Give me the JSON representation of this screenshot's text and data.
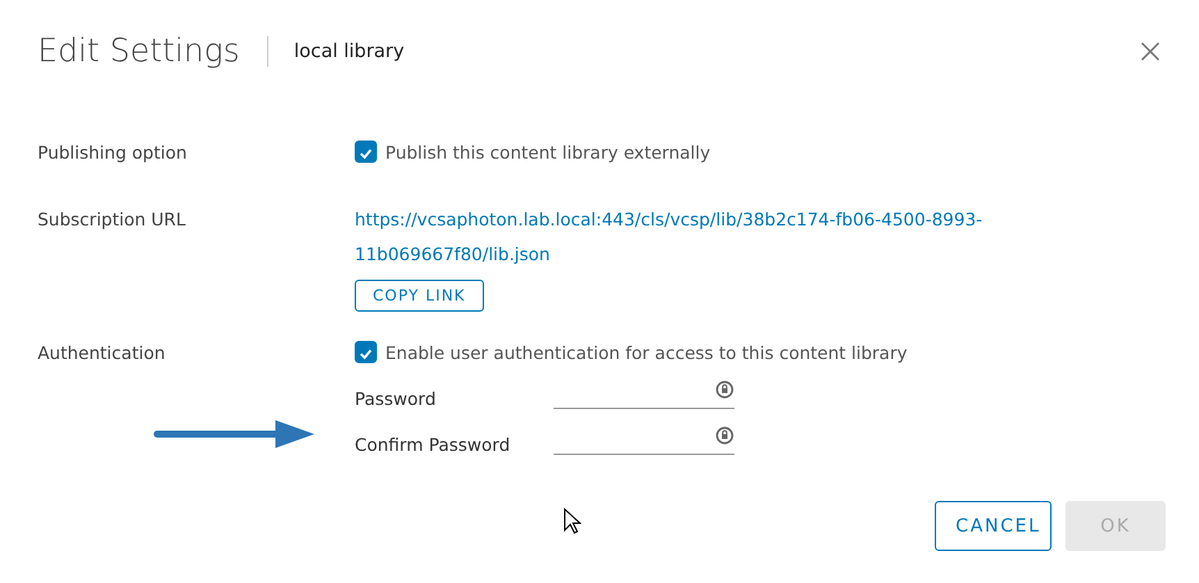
{
  "dialog": {
    "title": "Edit Settings",
    "subtitle": "local library"
  },
  "publishing": {
    "label": "Publishing option",
    "checkbox": {
      "label": "Publish this content library externally",
      "checked": true
    }
  },
  "subscription": {
    "label": "Subscription URL",
    "url_lines": [
      "https://vcsaphoton.lab.local:443/cls/vcsp/lib/38b2c174-fb06-4500-8993-",
      "11b069667f80/lib.json"
    ],
    "copy_button": "COPY LINK"
  },
  "authentication": {
    "label": "Authentication",
    "checkbox": {
      "label": "Enable user authentication for access to this content library",
      "checked": true
    },
    "fields": [
      {
        "label": "Password"
      },
      {
        "label": "Confirm Password"
      }
    ]
  },
  "buttons": [
    {
      "label": "CANCEL",
      "kind": "outline",
      "disabled": false
    },
    {
      "label": "OK",
      "kind": "primary",
      "disabled": true
    }
  ]
}
